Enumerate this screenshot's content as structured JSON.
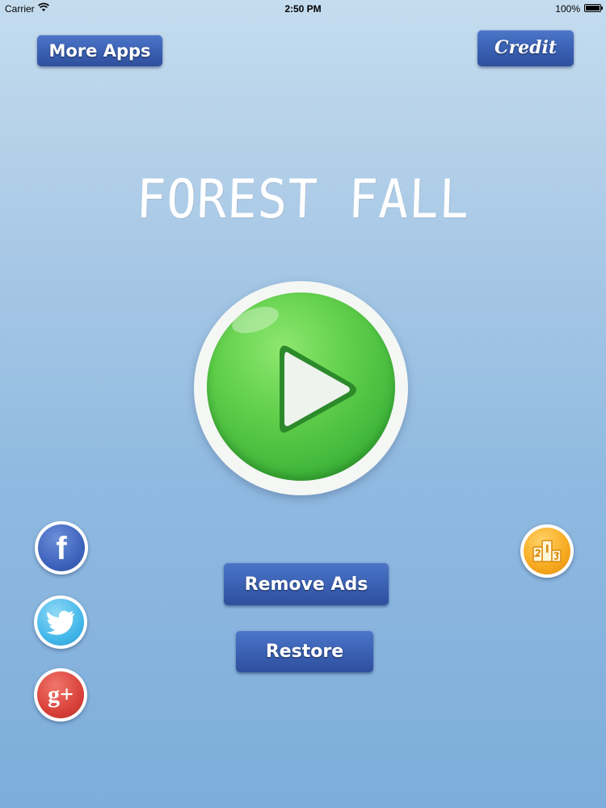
{
  "status_bar": {
    "carrier": "Carrier",
    "wifi_icon": "wifi-icon",
    "time": "2:50 PM",
    "battery": "100%",
    "battery_icon": "battery-icon"
  },
  "top_bar": {
    "more_apps_label": "More Apps",
    "credit_label": "Credit"
  },
  "title": "FOREST FALL",
  "play_button": {
    "icon": "play-icon"
  },
  "actions": {
    "remove_ads_label": "Remove Ads",
    "restore_label": "Restore"
  },
  "social": {
    "facebook_glyph": "f",
    "twitter_icon": "twitter-bird-icon",
    "gplus_glyph": "g+"
  },
  "leaderboard": {
    "icon": "podium-icon"
  },
  "colors": {
    "button_blue": "#3a60b3",
    "play_green": "#5fce4a",
    "facebook_blue": "#3f64bd",
    "twitter_blue": "#45b8ea",
    "gplus_red": "#d9423a",
    "leaderboard_orange": "#f7a91e"
  }
}
